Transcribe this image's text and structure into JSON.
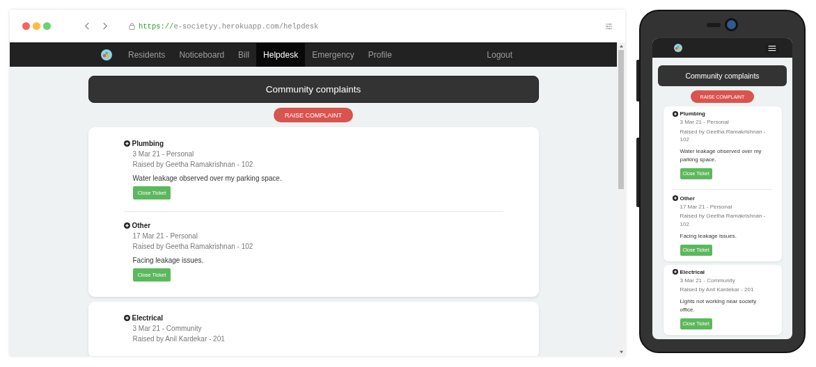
{
  "browser": {
    "url_scheme": "https://",
    "url_rest": "e-societyy.herokuapp.com/helpdesk"
  },
  "nav": {
    "items": [
      {
        "label": "Residents",
        "selected": false
      },
      {
        "label": "Noticeboard",
        "selected": false
      },
      {
        "label": "Bill",
        "selected": false
      },
      {
        "label": "Helpdesk",
        "selected": true
      },
      {
        "label": "Emergency",
        "selected": false
      },
      {
        "label": "Profile",
        "selected": false
      }
    ],
    "logout": "Logout"
  },
  "desktop": {
    "title": "Community complaints",
    "raise_button": "RAISE COMPLAINT",
    "cards": [
      {
        "tickets": [
          {
            "category": "Plumbing",
            "meta": "3 Mar 21 - Personal",
            "raised_by": "Raised by Geetha Ramakrishnan - 102",
            "description": "Water leakage observed over my parking space.",
            "button": "Close Ticket"
          },
          {
            "category": "Other",
            "meta": "17 Mar 21 - Personal",
            "raised_by": "Raised by Geetha Ramakrishnan - 102",
            "description": "Facing leakage issues.",
            "button": "Close Ticket"
          }
        ]
      },
      {
        "tickets": [
          {
            "category": "Electrical",
            "meta": "3 Mar 21 - Community",
            "raised_by": "Raised by Anil Kardekar - 201"
          }
        ]
      }
    ]
  },
  "mobile": {
    "title": "Community complaints",
    "raise_button": "RAISE COMPLAINT",
    "cards": [
      {
        "tickets": [
          {
            "category": "Plumbing",
            "meta": "3 Mar 21 - Personal",
            "raised_by": "Raised by Geetha Ramakrishnan - 102",
            "description": "Water leakage observed over my parking space.",
            "button": "Close Ticket"
          },
          {
            "category": "Other",
            "meta": "17 Mar 21 - Personal",
            "raised_by": "Raised by Geetha Ramakrishnan - 102",
            "description": "Facing leakage issues.",
            "button": "Close Ticket"
          }
        ]
      },
      {
        "tickets": [
          {
            "category": "Electrical",
            "meta": "3 Mar 21 - Community",
            "raised_by": "Raised by Anil Kardekar - 201",
            "description": "Lights not working near society office.",
            "button": "Close Ticket"
          }
        ]
      }
    ]
  }
}
